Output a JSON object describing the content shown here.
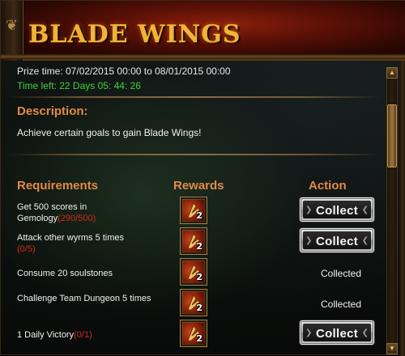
{
  "header": {
    "title": "BLADE WINGS"
  },
  "prize_time": "Prize time: 07/02/2015 00:00 to 08/01/2015 00:00",
  "time_left": "Time left: 22 Days  05: 44: 26",
  "description": {
    "heading": "Description:",
    "text": "Achieve certain goals to gain Blade Wings!"
  },
  "columns": {
    "requirements": "Requirements",
    "rewards": "Rewards",
    "action": "Action"
  },
  "rows": [
    {
      "req": "Get 500 scores in Gemology",
      "progress": "(290/500)",
      "reward_qty": "2",
      "action": "Collect",
      "state": "button"
    },
    {
      "req": "Attack other wyrms 5 times",
      "progress": "(0/5)",
      "reward_qty": "2",
      "action": "Collect",
      "state": "button"
    },
    {
      "req": "Consume 20 soulstones",
      "progress": "",
      "reward_qty": "2",
      "action": "Collected",
      "state": "text"
    },
    {
      "req": "Challenge Team Dungeon 5 times",
      "progress": "",
      "reward_qty": "2",
      "action": "Collected",
      "state": "text"
    },
    {
      "req": "1 Daily Victory",
      "progress": "(0/1)",
      "reward_qty": "2",
      "action": "Collect",
      "state": "button"
    }
  ],
  "icons": {
    "ornament": "scroll-ornament-icon",
    "reward": "blade-wings-reward-icon",
    "arrow_left": "arrow-left-icon",
    "arrow_right": "arrow-right-icon",
    "scroll_up": "scroll-up-icon",
    "scroll_down": "scroll-down-icon"
  },
  "colors": {
    "title": "#f2b33a",
    "accent_heading": "#e28a4a",
    "time_left": "#3ed23e",
    "progress": "#d12a1a"
  }
}
